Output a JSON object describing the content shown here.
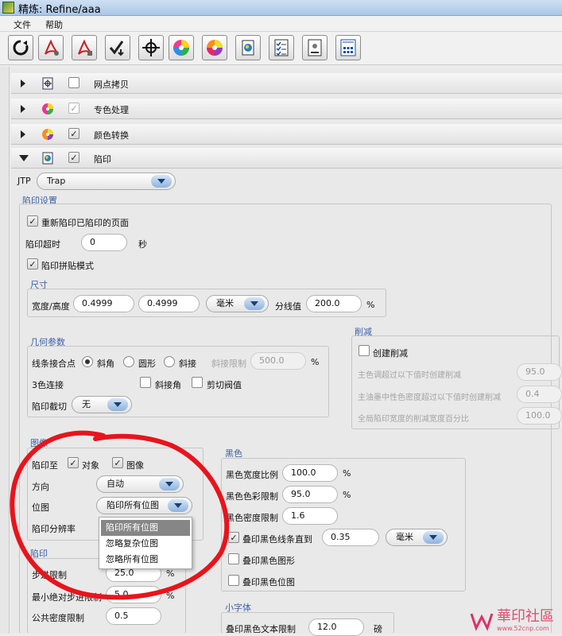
{
  "window": {
    "title": "精炼: Refine/aaa"
  },
  "menu": {
    "file": "文件",
    "help": "帮助"
  },
  "toolbar": {
    "icons": [
      "refresh-icon",
      "pdf-icon",
      "pdf-alt-icon",
      "check-down-icon",
      "crosshair-icon",
      "color-wheel-icon",
      "color-wheel-alt-icon",
      "trap-icon",
      "checklist-icon",
      "page-icon",
      "grid-icon"
    ]
  },
  "sections": [
    {
      "label": "网点拷贝",
      "expanded": false,
      "checked": false,
      "disabled": false
    },
    {
      "label": "专色处理",
      "expanded": false,
      "checked": true,
      "disabled": true
    },
    {
      "label": "颜色转换",
      "expanded": false,
      "checked": true,
      "disabled": false
    },
    {
      "label": "陷印",
      "expanded": true,
      "checked": true,
      "disabled": false
    }
  ],
  "jtp": {
    "label": "JTP",
    "value": "Trap"
  },
  "trap_settings": {
    "title": "陷印设置",
    "retrap": "重新陷印已陷印的页面",
    "timeout_label": "陷印超时",
    "timeout_value": "0",
    "timeout_unit": "秒",
    "tile_mode": "陷印拼贴模式"
  },
  "size": {
    "title": "尺寸",
    "wh_label": "宽度/高度",
    "width": "0.4999",
    "height": "0.4999",
    "unit": "毫米",
    "split_label": "分线值",
    "split_value": "200.0",
    "split_unit": "%"
  },
  "geometry": {
    "title": "几何参数",
    "join_label": "线条接合点",
    "join_miter": "斜角",
    "join_round": "圆形",
    "join_bevel": "斜接",
    "miter_limit_label": "斜接限制",
    "miter_limit_value": "500.0",
    "miter_limit_unit": "%",
    "three_color": "3色连接",
    "bevel_corner": "斜接角",
    "cut_threshold": "剪切阀值",
    "trap_crop_label": "陷印截切",
    "trap_crop_value": "无"
  },
  "reduce": {
    "title": "削减",
    "create": "创建削减",
    "row1_label": "主色调超过以下值时创建削减",
    "row1_value": "95.0",
    "row2_label": "主油墨中性色密度超过以下值时创建削减",
    "row2_value": "0.4",
    "row3_label": "全局陷印宽度的削减宽度百分比",
    "row3_value": "100.0"
  },
  "image": {
    "title": "图像",
    "trap_to": "陷印至",
    "object": "对象",
    "image": "图像",
    "direction_label": "方向",
    "direction_value": "自动",
    "bitmap_label": "位图",
    "bitmap_value": "陷印所有位图",
    "resolution_label": "陷印分辨率",
    "options": [
      "陷印所有位图",
      "忽略复杂位图",
      "忽略所有位图"
    ]
  },
  "trap": {
    "title": "陷印",
    "step_label": "步进限制",
    "step_value": "25.0",
    "step_unit": "%",
    "min_step_label": "最小绝对步进限制",
    "min_step_value": "5.0",
    "min_step_unit": "%",
    "density_label": "公共密度限制",
    "density_value": "0.5"
  },
  "black": {
    "title": "黑色",
    "width_ratio_label": "黑色宽度比例",
    "width_ratio_value": "100.0",
    "width_ratio_unit": "%",
    "color_limit_label": "黑色色彩限制",
    "color_limit_value": "95.0",
    "color_limit_unit": "%",
    "density_label": "黑色密度限制",
    "density_value": "1.6",
    "overprint_lines_label": "叠印黑色线条直到",
    "overprint_lines_value": "0.35",
    "overprint_lines_unit": "毫米",
    "overprint_graphics": "叠印黑色图形",
    "overprint_bitmaps": "叠印黑色位图"
  },
  "small_text": {
    "title": "小字体",
    "overprint_label": "叠印黑色文本限制",
    "overprint_value": "12.0",
    "overprint_unit": "磅"
  },
  "watermark": {
    "text": "華印社區",
    "sub": "www.52cnp.com"
  }
}
